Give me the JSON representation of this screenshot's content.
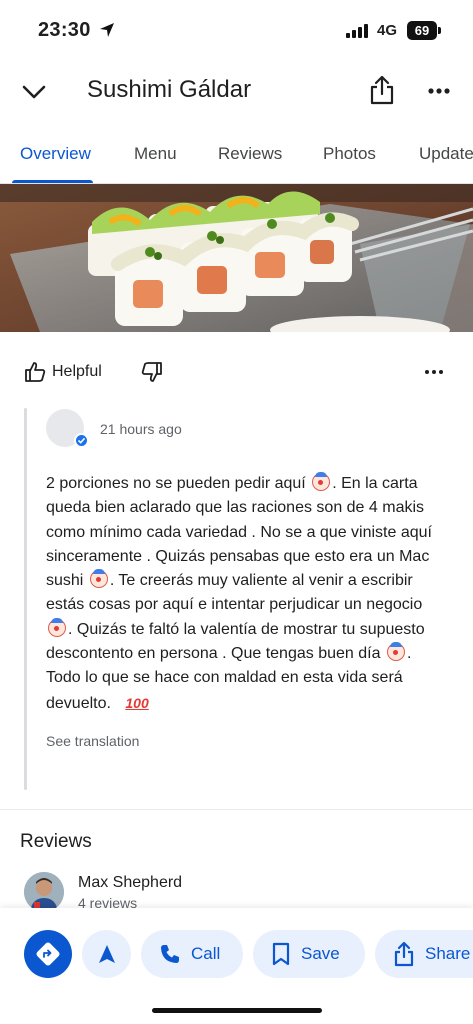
{
  "status_bar": {
    "time": "23:30",
    "network": "4G",
    "battery": "69"
  },
  "header": {
    "title": "Sushimi Gáldar"
  },
  "tabs": [
    {
      "label": "Overview",
      "active": true
    },
    {
      "label": "Menu"
    },
    {
      "label": "Reviews"
    },
    {
      "label": "Photos"
    },
    {
      "label": "Updates"
    }
  ],
  "review_actions": {
    "helpful_label": "Helpful"
  },
  "owner_reply": {
    "time": "21 hours ago",
    "segments": [
      "2 porciones no se pueden pedir aquí",
      ". En la carta queda bien aclarado que las raciones son de 4 makis como mínimo cada variedad .  No se a que viniste aquí sinceramente . Quizás pensabas que esto era un Mac sushi",
      ". Te creerás muy valiente al venir a escribir estás cosas por aquí e intentar perjudicar un negocio",
      ". Quizás te faltó la valentía de mostrar tu supuesto descontento en persona .  Que tengas buen día",
      ". Todo lo que se hace con maldad en esta vida será devuelto."
    ],
    "emoji_end": "100",
    "see_translation": "See translation"
  },
  "reviews": {
    "heading": "Reviews",
    "first": {
      "name": "Max Shepherd",
      "count": "4 reviews"
    }
  },
  "bottom_actions": {
    "call": "Call",
    "save": "Save",
    "share": "Share"
  },
  "colors": {
    "accent": "#0b57d0",
    "accent_light": "#e8f0fe",
    "verified": "#1a73e8"
  },
  "icons": [
    "location-arrow-icon",
    "signal-icon",
    "battery-icon",
    "chevron-down-icon",
    "share-icon",
    "more-icon",
    "thumb-up-icon",
    "thumb-down-icon",
    "verified-icon",
    "clown-emoji-icon",
    "directions-icon",
    "navigation-arrow-icon",
    "phone-icon",
    "bookmark-icon"
  ]
}
